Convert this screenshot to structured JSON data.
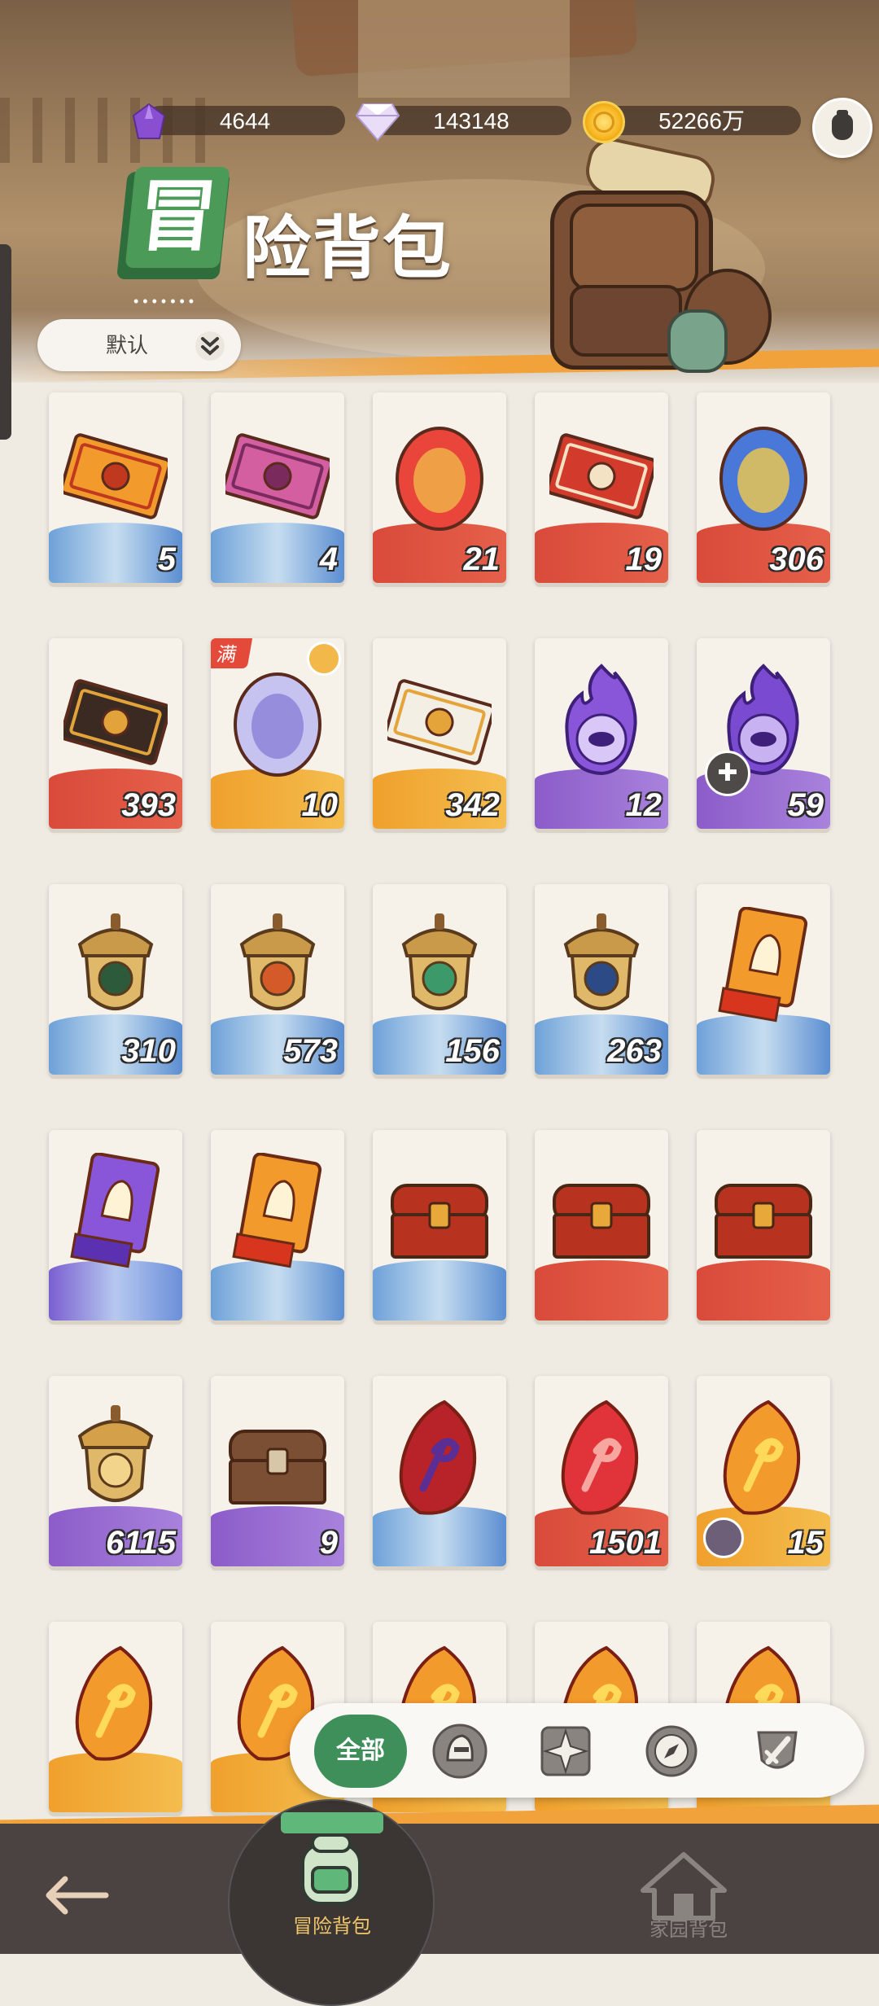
{
  "currencies": {
    "amethyst": "4644",
    "diamond": "143148",
    "gold": "52266万"
  },
  "title": {
    "badge_char": "冒",
    "text": "险背包"
  },
  "sort": {
    "label": "默认"
  },
  "items": [
    {
      "qty": "5",
      "band": "blue",
      "icon": "exchange-ticket-orange-icon"
    },
    {
      "qty": "4",
      "band": "blue",
      "icon": "exchange-ticket-purple-icon"
    },
    {
      "qty": "21",
      "band": "red",
      "icon": "heart-amulet-icon"
    },
    {
      "qty": "19",
      "band": "red",
      "icon": "red-letter-envelope-icon"
    },
    {
      "qty": "306",
      "band": "red",
      "icon": "crystal-orb-icon"
    },
    {
      "qty": "393",
      "band": "red",
      "icon": "black-gold-envelope-icon"
    },
    {
      "qty": "10",
      "band": "orange",
      "icon": "mirror-egg-icon",
      "tag": "满"
    },
    {
      "qty": "342",
      "band": "orange",
      "icon": "white-envelope-icon"
    },
    {
      "qty": "12",
      "band": "purple",
      "icon": "purple-eye-flame-icon"
    },
    {
      "qty": "59",
      "band": "purple",
      "icon": "purple-trident-flame-icon"
    },
    {
      "qty": "310",
      "band": "blue",
      "icon": "acorn-eye-badge-icon"
    },
    {
      "qty": "573",
      "band": "blue",
      "icon": "acorn-sun-badge-icon"
    },
    {
      "qty": "156",
      "band": "blue",
      "icon": "acorn-leaf-badge-icon"
    },
    {
      "qty": "263",
      "band": "blue",
      "icon": "acorn-star-badge-icon"
    },
    {
      "qty": "",
      "band": "blue",
      "icon": "orange-helmet-card-icon"
    },
    {
      "qty": "",
      "band": "bluepurple",
      "icon": "purple-helmet-card-icon"
    },
    {
      "qty": "",
      "band": "blue",
      "icon": "orange-helmet-card-anchor-icon"
    },
    {
      "qty": "",
      "band": "blue",
      "icon": "treasure-chest-red-icon"
    },
    {
      "qty": "",
      "band": "red",
      "icon": "treasure-chest-red-icon"
    },
    {
      "qty": "",
      "band": "red",
      "icon": "treasure-chest-red-icon"
    },
    {
      "qty": "6115",
      "band": "purple",
      "icon": "acorn-diamond-badge-icon"
    },
    {
      "qty": "9",
      "band": "purple",
      "icon": "wooden-chest-icon"
    },
    {
      "qty": "",
      "band": "blue",
      "icon": "red-rune-crystal-icon"
    },
    {
      "qty": "1501",
      "band": "red",
      "icon": "red-rune-shard-icon"
    },
    {
      "qty": "15",
      "band": "orange",
      "icon": "gold-rune-shard-icon"
    },
    {
      "qty": "",
      "band": "orange",
      "icon": "gold-rune-shard-icon"
    },
    {
      "qty": "",
      "band": "orange",
      "icon": "gold-rune-shard-icon"
    },
    {
      "qty": "",
      "band": "orange",
      "icon": "gold-rune-shard-icon"
    },
    {
      "qty": "",
      "band": "orange",
      "icon": "gold-rune-shard-icon"
    },
    {
      "qty": "",
      "band": "orange",
      "icon": "gold-rune-shard-icon"
    }
  ],
  "filters": {
    "all": "全部",
    "icons": [
      "warrior-helmet-icon",
      "star-compass-icon",
      "compass-needle-icon",
      "shield-sword-icon"
    ]
  },
  "nav": {
    "adventure_bag": "冒险背包",
    "home_bag": "家园背包"
  },
  "colors": {
    "accent_green": "#3f8f5a",
    "qty_red_band": "#d94a3a",
    "orange_band": "#f2a23a"
  }
}
